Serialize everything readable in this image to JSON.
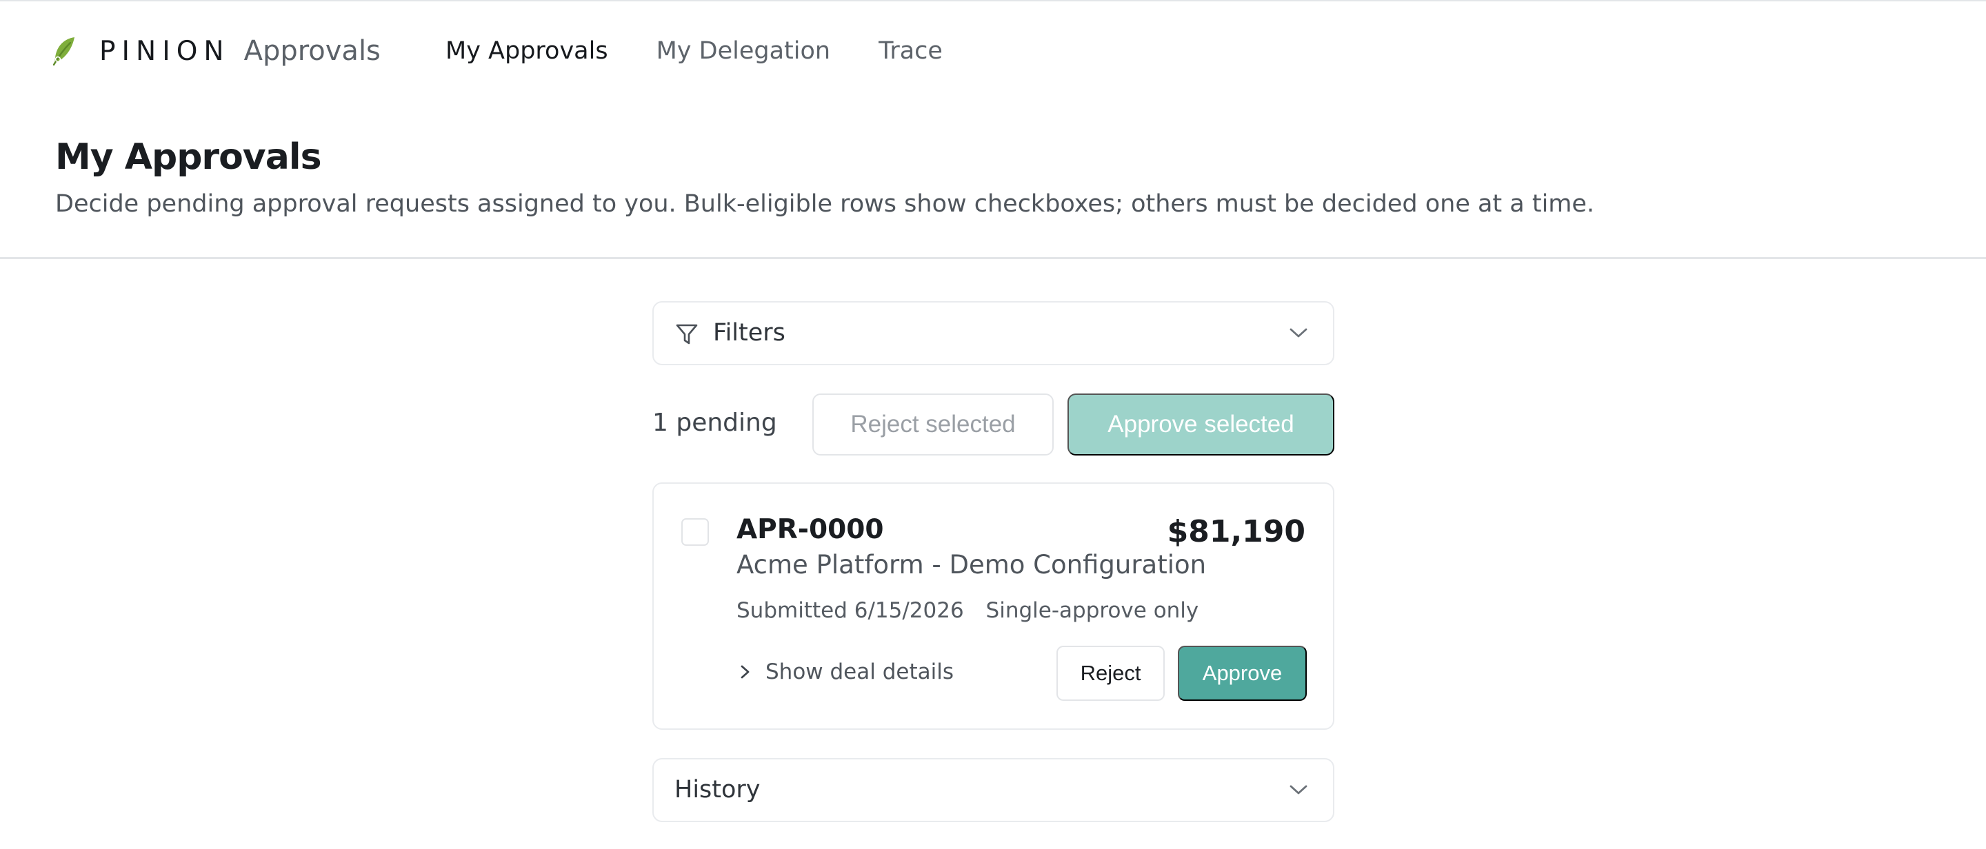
{
  "brand": {
    "name": "PINION",
    "product": "Approvals"
  },
  "nav": {
    "items": [
      {
        "label": "My Approvals",
        "active": true
      },
      {
        "label": "My Delegation",
        "active": false
      },
      {
        "label": "Trace",
        "active": false
      }
    ]
  },
  "page": {
    "title": "My Approvals",
    "subtitle": "Decide pending approval requests assigned to you. Bulk-eligible rows show checkboxes; others must be decided one at a time."
  },
  "filters": {
    "label": "Filters",
    "icon": "filter-icon"
  },
  "actions": {
    "pending_count": "1 pending",
    "reject_selected": "Reject selected",
    "approve_selected": "Approve selected"
  },
  "requests": [
    {
      "id": "APR-0000",
      "amount": "$81,190",
      "name": "Acme Platform - Demo Configuration",
      "submitted": "Submitted 6/15/2026",
      "mode": "Single-approve only",
      "details_label": "Show deal details",
      "reject_label": "Reject",
      "approve_label": "Approve"
    }
  ],
  "history": {
    "label": "History"
  },
  "colors": {
    "accent": "#4fa89d",
    "accent_disabled": "#9dd3ca",
    "leaf": "#7fae3c",
    "border": "#e9ebee"
  }
}
